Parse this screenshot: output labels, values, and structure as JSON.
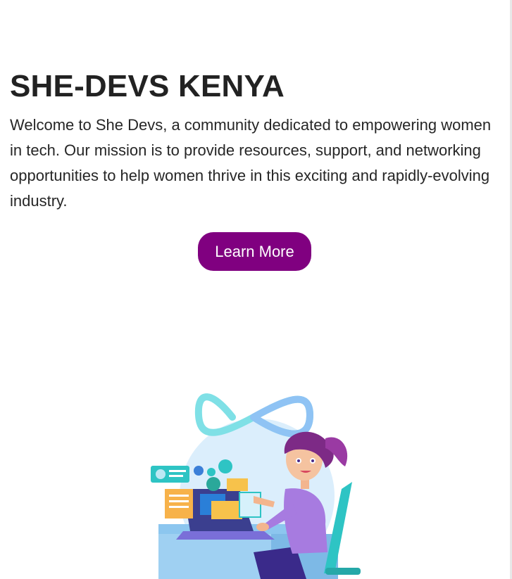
{
  "hero": {
    "title": "SHE-DEVS KENYA",
    "description": "Welcome to She Devs, a community dedicated to empowering women in tech. Our mission is to provide resources, support, and networking opportunities to help women thrive in this exciting and rapidly-evolving industry.",
    "cta_label": "Learn More"
  },
  "colors": {
    "cta_background": "#800080",
    "cta_text": "#ffffff",
    "title_text": "#222222",
    "body_text": "#262626"
  },
  "illustration": {
    "icon": "woman-developer-laptop-illustration"
  }
}
